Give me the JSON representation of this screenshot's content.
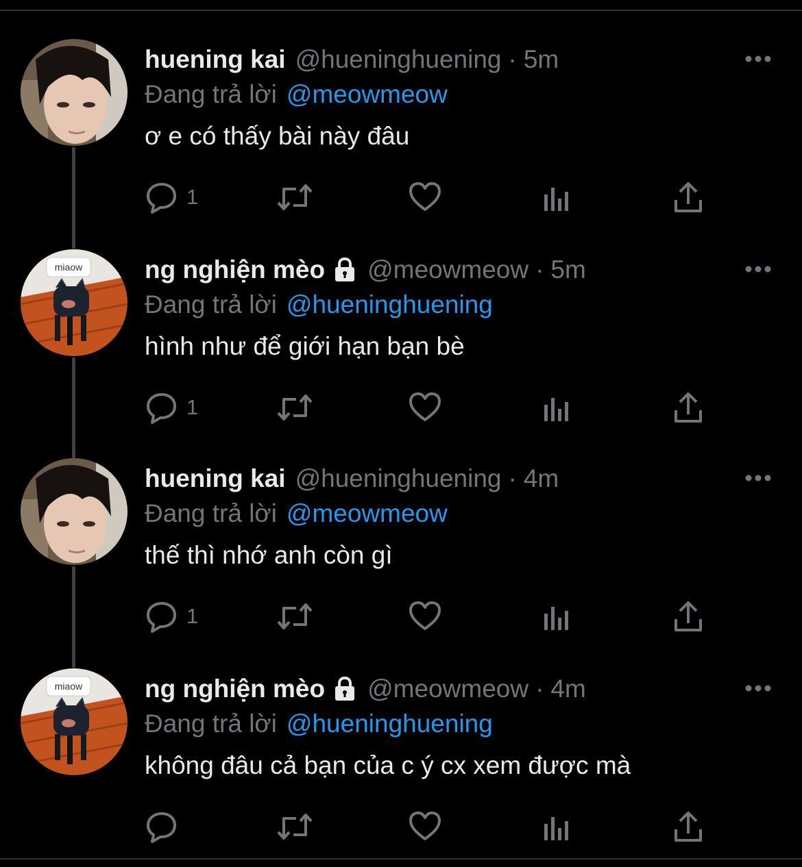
{
  "tweets": [
    {
      "name": "huening kai",
      "locked": false,
      "handle": "@hueninghuening",
      "separator": "·",
      "time": "5m",
      "replying_label": "Đang trả lời",
      "replying_to": "@meowmeow",
      "text": "ơ e có thấy bài này đâu",
      "reply_count": "1",
      "avatar": "person-photo"
    },
    {
      "name": "ng nghiện mèo",
      "locked": true,
      "handle": "@meowmeow",
      "separator": "·",
      "time": "5m",
      "replying_label": "Đang trả lời",
      "replying_to": "@hueninghuening",
      "text": "hình như để giới hạn bạn bè",
      "reply_count": "1",
      "avatar": "cat-chair",
      "avatar_tag": "miaow"
    },
    {
      "name": "huening kai",
      "locked": false,
      "handle": "@hueninghuening",
      "separator": "·",
      "time": "4m",
      "replying_label": "Đang trả lời",
      "replying_to": "@meowmeow",
      "text": "thế thì nhớ anh còn gì",
      "reply_count": "1",
      "avatar": "person-photo"
    },
    {
      "name": "ng nghiện mèo",
      "locked": true,
      "handle": "@meowmeow",
      "separator": "·",
      "time": "4m",
      "replying_label": "Đang trả lời",
      "replying_to": "@hueninghuening",
      "text": "không đâu cả bạn của c ý cx xem được mà",
      "reply_count": "",
      "avatar": "cat-chair",
      "avatar_tag": "miaow"
    }
  ],
  "icons": {
    "reply": "reply-icon",
    "retweet": "retweet-icon",
    "like": "heart-icon",
    "analytics": "analytics-icon",
    "share": "share-icon",
    "more": "more-icon",
    "lock": "lock-icon"
  },
  "colors": {
    "background": "#000000",
    "text": "#e7e9ea",
    "muted": "#71767b",
    "link": "#1d9bf0",
    "thread_line": "#3e4144"
  }
}
